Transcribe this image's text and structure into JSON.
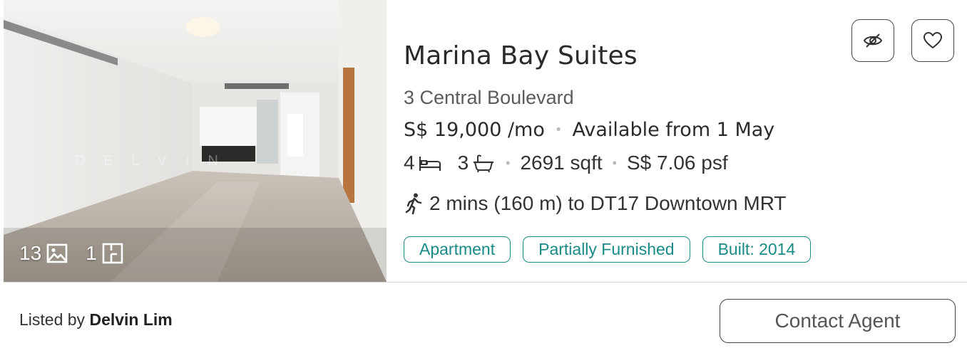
{
  "listing": {
    "title": "Marina Bay Suites",
    "address": "3 Central Boulevard",
    "price": "S$ 19,000 /mo",
    "availability": "Available from 1 May",
    "bedrooms": "4",
    "bathrooms": "3",
    "area": "2691 sqft",
    "psf": "S$ 7.06 psf",
    "mrt": "2 mins (160 m) to DT17 Downtown MRT",
    "separator": "•",
    "tags": [
      "Apartment",
      "Partially Furnished",
      "Built: 2014"
    ]
  },
  "photo": {
    "photo_count": "13",
    "floorplan_count": "1",
    "watermark": "DELVIN"
  },
  "footer": {
    "listed_by_prefix": "Listed by",
    "agent_name": "Delvin Lim",
    "contact_label": "Contact Agent"
  },
  "icons": {
    "hide": "eye-off-icon",
    "favorite": "heart-icon",
    "photos": "image-icon",
    "floorplan": "floorplan-icon",
    "bed": "bed-icon",
    "bath": "bathtub-icon",
    "walk": "walking-icon"
  },
  "colors": {
    "tag_accent": "#1a8a87",
    "border": "#444444",
    "text": "#2b2b2b"
  }
}
